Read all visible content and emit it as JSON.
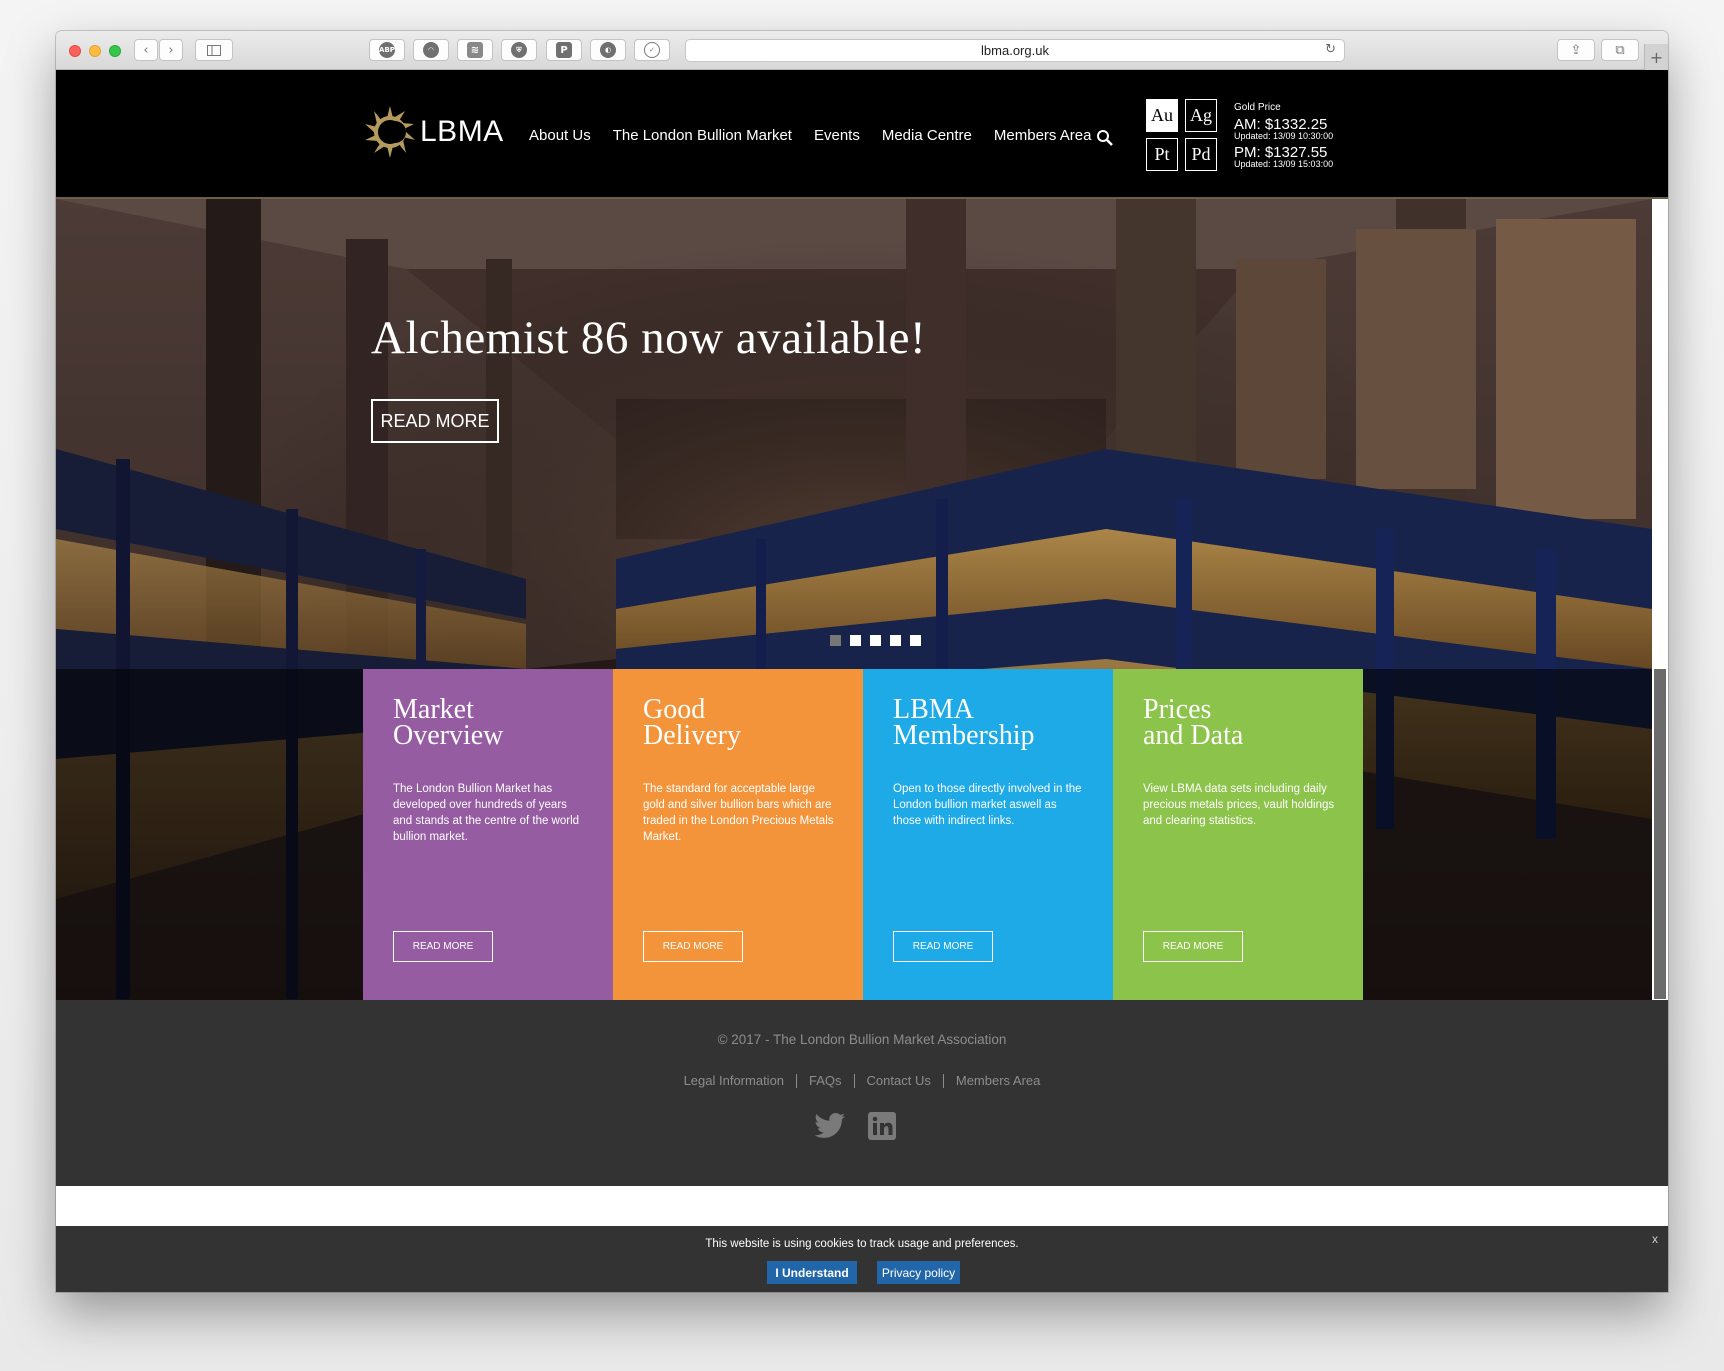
{
  "browser": {
    "url": "lbma.org.uk",
    "extensions": [
      "ABP",
      "ghost",
      "layers",
      "shield",
      "P",
      "bulb",
      "check-shield"
    ]
  },
  "header": {
    "logo_text": "LBMA",
    "nav": [
      "About Us",
      "The London Bullion Market",
      "Events",
      "Media Centre",
      "Members Area"
    ],
    "metals": [
      "Au",
      "Ag",
      "Pt",
      "Pd"
    ],
    "price_title": "Gold Price",
    "am_price": "AM: $1332.25",
    "am_updated": "Updated: 13/09 10:30:00",
    "pm_price": "PM: $1327.55",
    "pm_updated": "Updated: 13/09 15:03:00"
  },
  "hero": {
    "title": "Alchemist 86 now available!",
    "button": "READ MORE",
    "slides": 5,
    "active_slide": 1
  },
  "cards": [
    {
      "title": "Market\nOverview",
      "desc": "The London Bullion Market has developed over hundreds of years and stands at the centre of the world bullion market.",
      "button": "READ MORE",
      "color": "#955ca2"
    },
    {
      "title": "Good\nDelivery",
      "desc": "The standard for acceptable large gold and silver bullion bars which are traded in the London Precious Metals Market.",
      "button": "READ MORE",
      "color": "#f3943a"
    },
    {
      "title": "LBMA\nMembership",
      "desc": "Open to those directly involved in the London bullion market aswell as those with indirect links.",
      "button": "READ MORE",
      "color": "#1eaae7"
    },
    {
      "title": "Prices\nand Data",
      "desc": "View LBMA data sets including daily precious metals prices, vault holdings and clearing statistics.",
      "button": "READ MORE",
      "color": "#8cc34a"
    }
  ],
  "footer": {
    "copyright": "© 2017 - The London Bullion Market Association",
    "links": [
      "Legal Information",
      "FAQs",
      "Contact Us",
      "Members Area"
    ]
  },
  "cookie": {
    "text": "This website is using cookies to track usage and preferences.",
    "accept": "I Understand",
    "policy": "Privacy policy",
    "close": "x"
  },
  "colors": {
    "accent_gold": "#b59a5e",
    "cookie_button": "#2266aa"
  }
}
